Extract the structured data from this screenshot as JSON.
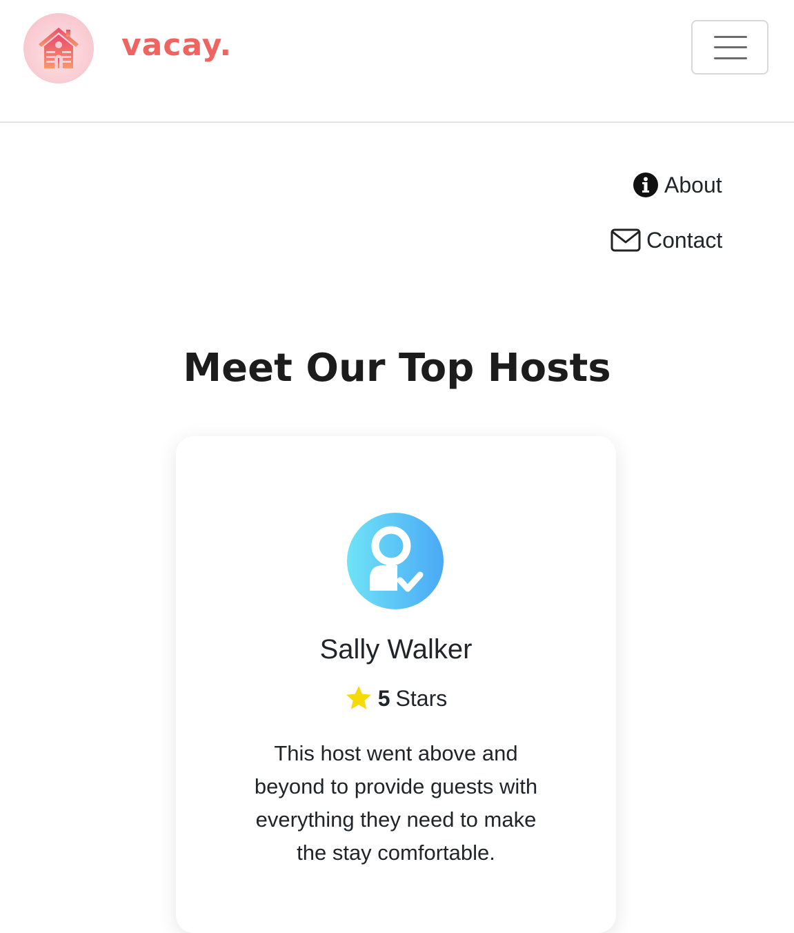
{
  "header": {
    "brand": "vacay.",
    "logo_icon": "house-icon",
    "menu_icon": "hamburger-menu-icon"
  },
  "nav": {
    "items": [
      {
        "label": "About",
        "icon": "info-circle-icon"
      },
      {
        "label": "Contact",
        "icon": "envelope-icon"
      }
    ]
  },
  "hosts": {
    "title": "Meet Our Top Hosts",
    "cards": [
      {
        "name": "Sally Walker",
        "avatar_icon": "verified-user-icon",
        "rating_icon": "star-icon",
        "rating_value": "5",
        "rating_label": "Stars",
        "description": "This host went above and beyond to provide guests with everything they need to make the stay comfortable."
      }
    ]
  },
  "colors": {
    "brand": "#ef6461",
    "avatar_gradient_start": "#6fe3f7",
    "avatar_gradient_end": "#4aa9f5",
    "star": "#f5d90a"
  }
}
